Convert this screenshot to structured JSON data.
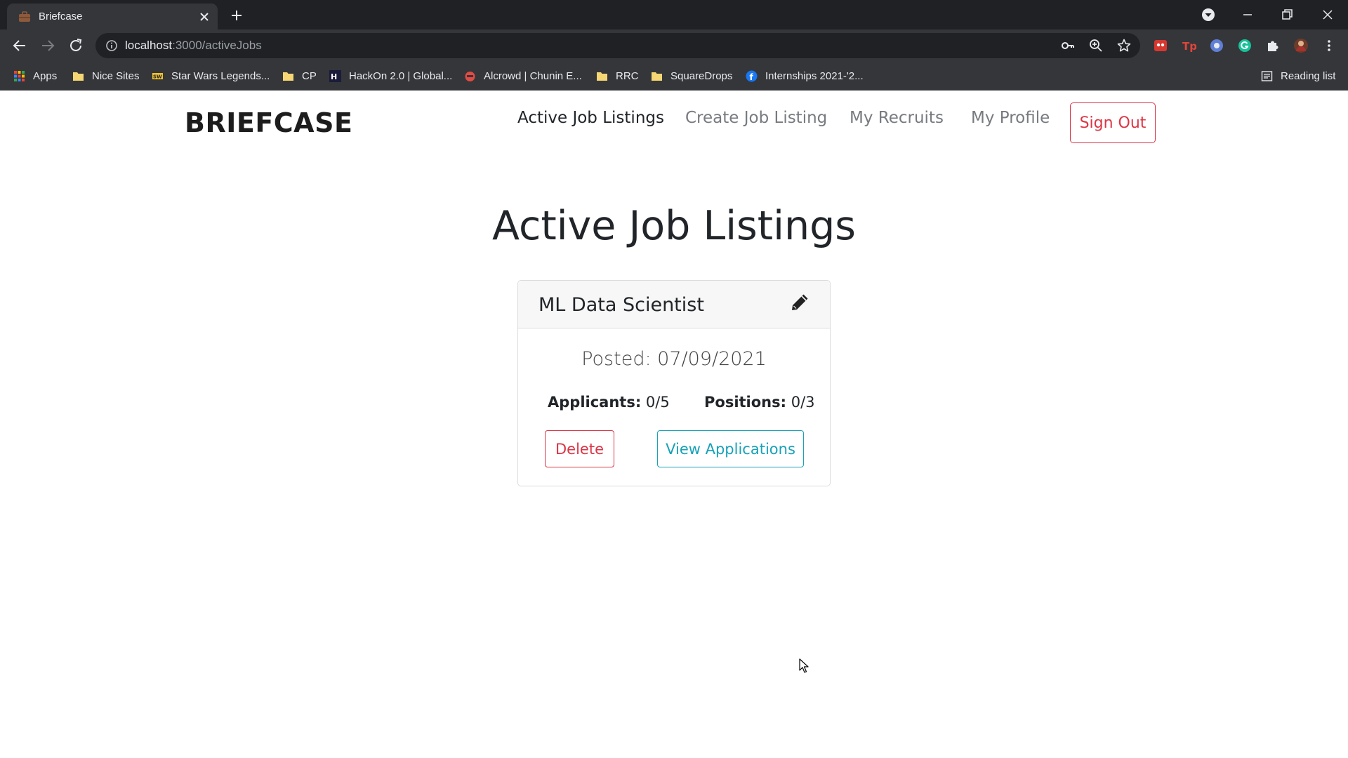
{
  "browser": {
    "tab_title": "Briefcase",
    "url_host": "localhost",
    "url_path": ":3000/activeJobs",
    "bookmarks": [
      {
        "label": "Apps",
        "icon": "apps-grid-icon"
      },
      {
        "label": "Nice Sites",
        "icon": "folder-icon"
      },
      {
        "label": "Star Wars Legends...",
        "icon": "star-wars-icon"
      },
      {
        "label": "CP",
        "icon": "folder-icon"
      },
      {
        "label": "HackOn 2.0 | Global...",
        "icon": "hackon-icon"
      },
      {
        "label": "Alcrowd | Chunin E...",
        "icon": "aicrowd-icon"
      },
      {
        "label": "RRC",
        "icon": "folder-icon"
      },
      {
        "label": "SquareDrops",
        "icon": "folder-icon"
      },
      {
        "label": "Internships 2021-'2...",
        "icon": "facebook-icon"
      }
    ],
    "reading_list": "Reading list",
    "colors": {
      "chrome_dark": "#202124",
      "chrome_toolbar": "#35363a",
      "folder": "#f7d774"
    }
  },
  "app": {
    "brand": "BRIEFCASE",
    "nav": {
      "active_jobs": "Active Job Listings",
      "create_job": "Create Job Listing",
      "recruits": "My Recruits",
      "profile": "My Profile",
      "sign_out": "Sign Out"
    },
    "page_title": "Active Job Listings",
    "colors": {
      "danger": "#dc3545",
      "info": "#17a2b8",
      "text": "#212529",
      "muted": "#777b80"
    }
  },
  "job": {
    "title": "ML Data Scientist",
    "posted_label": "Posted:",
    "posted_date": "07/09/2021",
    "applicants_label": "Applicants:",
    "applicants_value": "0/5",
    "positions_label": "Positions:",
    "positions_value": "0/3",
    "delete_label": "Delete",
    "view_label": "View Applications"
  }
}
